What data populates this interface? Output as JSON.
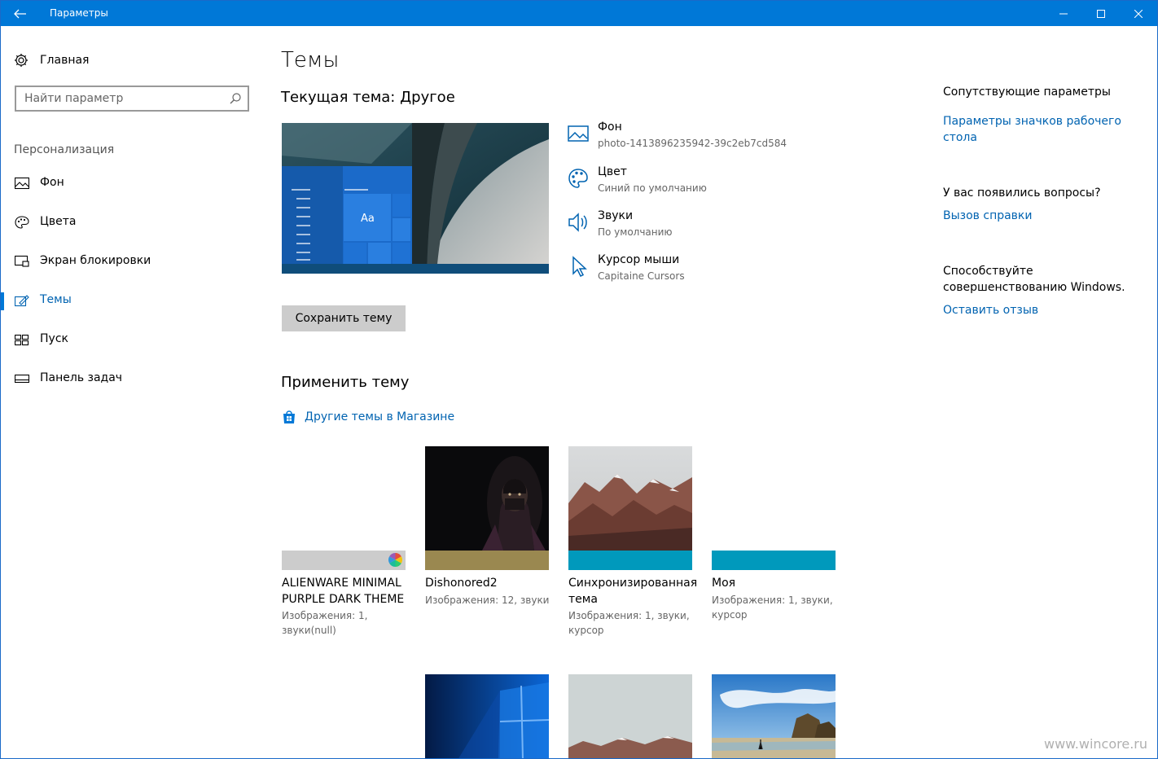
{
  "window": {
    "title": "Параметры"
  },
  "sidebar": {
    "home_label": "Главная",
    "search_placeholder": "Найти параметр",
    "section_label": "Персонализация",
    "items": [
      {
        "label": "Фон",
        "icon": "picture-icon"
      },
      {
        "label": "Цвета",
        "icon": "palette-icon"
      },
      {
        "label": "Экран блокировки",
        "icon": "lock-screen-icon"
      },
      {
        "label": "Темы",
        "icon": "themes-icon",
        "active": true
      },
      {
        "label": "Пуск",
        "icon": "start-icon"
      },
      {
        "label": "Панель задач",
        "icon": "taskbar-icon"
      }
    ]
  },
  "main": {
    "title": "Темы",
    "current_theme": "Текущая тема: Другое",
    "preview_text": "Aa",
    "properties": [
      {
        "name": "Фон",
        "value": "photo-1413896235942-39c2eb7cd584",
        "icon": "picture-icon"
      },
      {
        "name": "Цвет",
        "value": "Синий по умолчанию",
        "icon": "palette-icon"
      },
      {
        "name": "Звуки",
        "value": "По умолчанию",
        "icon": "speaker-icon"
      },
      {
        "name": "Курсор мыши",
        "value": "Capitaine Cursors",
        "icon": "cursor-icon"
      }
    ],
    "save_button": "Сохранить тему",
    "apply_title": "Применить тему",
    "store_link": "Другие темы в Магазине",
    "themes": [
      {
        "name": "ALIENWARE MINIMAL PURPLE DARK THEME",
        "desc": "Изображения: 1, звуки(null)",
        "bar_color": "#cccccc"
      },
      {
        "name": "Dishonored2",
        "desc": "Изображения: 12, звуки",
        "bar_color": "#9a8850"
      },
      {
        "name": "Синхронизированная тема",
        "desc": "Изображения: 1, звуки, курсор",
        "bar_color": "#0099bc"
      },
      {
        "name": "Моя",
        "desc": "Изображения: 1, звуки, курсор",
        "bar_color": "#0099bc"
      }
    ]
  },
  "right": {
    "related_heading": "Сопутствующие параметры",
    "related_link": "Параметры значков рабочего стола",
    "questions_heading": "У вас появились вопросы?",
    "help_link": "Вызов справки",
    "improve_heading": "Способствуйте совершенствованию Windows.",
    "feedback_link": "Оставить отзыв"
  },
  "watermark": "www.wincore.ru",
  "colors": {
    "accent": "#0078d7",
    "link": "#0063b1"
  }
}
